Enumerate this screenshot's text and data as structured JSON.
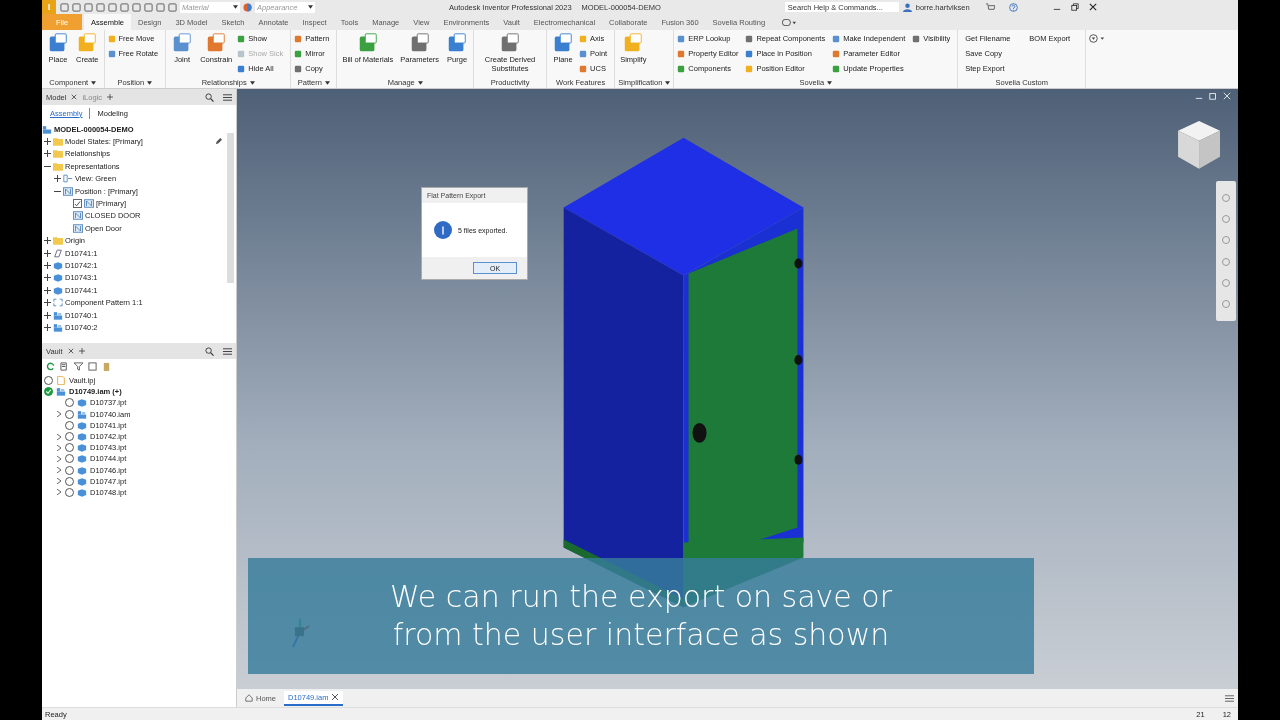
{
  "title_bar": {
    "logo_letter": "I",
    "material": "Material",
    "appearance": "Appearance",
    "app_title": "Autodesk Inventor Professional 2023",
    "document": "MODEL-000054-DEMO",
    "search": {
      "placeholder": "Search Help & Commands..."
    },
    "user": "borre.hartviksen"
  },
  "tabs": [
    {
      "label": "File",
      "kind": "file",
      "selected": false
    },
    {
      "label": "Assemble",
      "kind": "tab",
      "selected": true
    },
    {
      "label": "Design",
      "kind": "tab",
      "selected": false
    },
    {
      "label": "3D Model",
      "kind": "tab",
      "selected": false
    },
    {
      "label": "Sketch",
      "kind": "tab",
      "selected": false
    },
    {
      "label": "Annotate",
      "kind": "tab",
      "selected": false
    },
    {
      "label": "Inspect",
      "kind": "tab",
      "selected": false
    },
    {
      "label": "Tools",
      "kind": "tab",
      "selected": false
    },
    {
      "label": "Manage",
      "kind": "tab",
      "selected": false
    },
    {
      "label": "View",
      "kind": "tab",
      "selected": false
    },
    {
      "label": "Environments",
      "kind": "tab",
      "selected": false
    },
    {
      "label": "Vault",
      "kind": "tab",
      "selected": false
    },
    {
      "label": "Electromechanical",
      "kind": "tab",
      "selected": false
    },
    {
      "label": "Collaborate",
      "kind": "tab",
      "selected": false
    },
    {
      "label": "Fusion 360",
      "kind": "tab",
      "selected": false
    },
    {
      "label": "Sovelia Routing",
      "kind": "tab",
      "selected": false
    }
  ],
  "ribbon": [
    {
      "title": "Component",
      "has_menu": true,
      "tools": [
        {
          "label": "Place",
          "kind": "large"
        },
        {
          "label": "Create",
          "kind": "large"
        }
      ]
    },
    {
      "title": "Position",
      "has_menu": true,
      "tools": [
        {
          "label": "Free Move",
          "kind": "small"
        },
        {
          "label": "Free Rotate",
          "kind": "small"
        }
      ]
    },
    {
      "title": "Relationships",
      "has_menu": true,
      "tools": [
        {
          "label": "Joint",
          "kind": "large"
        },
        {
          "label": "Constrain",
          "kind": "large"
        },
        {
          "label": "Show",
          "kind": "small",
          "disabled": false
        },
        {
          "label": "Show Sick",
          "kind": "small",
          "disabled": true
        },
        {
          "label": "Hide All",
          "kind": "small",
          "disabled": false
        }
      ]
    },
    {
      "title": "Pattern",
      "has_menu": true,
      "tools": [
        {
          "label": "Pattern",
          "kind": "small"
        },
        {
          "label": "Mirror",
          "kind": "small"
        },
        {
          "label": "Copy",
          "kind": "small"
        }
      ]
    },
    {
      "title": "Manage",
      "has_menu": true,
      "tools": [
        {
          "label": "Bill of Materials",
          "kind": "large"
        },
        {
          "label": "Parameters",
          "kind": "large"
        },
        {
          "label": "Purge",
          "kind": "large"
        }
      ]
    },
    {
      "title": "Productivity",
      "has_menu": false,
      "tools": [
        {
          "label": "Create Derived Substitutes",
          "kind": "large"
        }
      ]
    },
    {
      "title": "Work Features",
      "has_menu": false,
      "tools": [
        {
          "label": "Plane",
          "kind": "large"
        },
        {
          "label": "Axis",
          "kind": "small"
        },
        {
          "label": "Point",
          "kind": "small"
        },
        {
          "label": "UCS",
          "kind": "small"
        }
      ]
    },
    {
      "title": "Simplification",
      "has_menu": true,
      "tools": [
        {
          "label": "Simplify",
          "kind": "large"
        }
      ]
    },
    {
      "title": "Sovelia",
      "has_menu": true,
      "tools": [
        {
          "label": "ERP Lookup",
          "kind": "small"
        },
        {
          "label": "Property Editor",
          "kind": "small"
        },
        {
          "label": "Components",
          "kind": "small"
        },
        {
          "label": "Repeat Components",
          "kind": "small"
        },
        {
          "label": "Place in Position",
          "kind": "small"
        },
        {
          "label": "Position Editor",
          "kind": "small"
        },
        {
          "label": "Make Independent",
          "kind": "small"
        },
        {
          "label": "Parameter Editor",
          "kind": "small"
        },
        {
          "label": "Update Properties",
          "kind": "small"
        },
        {
          "label": "Visibility",
          "kind": "small"
        }
      ]
    },
    {
      "title": "Sovelia Custom",
      "has_menu": false,
      "tools": [
        {
          "label": "Get Filename",
          "kind": "text"
        },
        {
          "label": "Save Copy",
          "kind": "text"
        },
        {
          "label": "Step Export",
          "kind": "text"
        },
        {
          "label": "BOM Export",
          "kind": "text"
        }
      ]
    }
  ],
  "model_browser": {
    "tabs": [
      {
        "label": "Model",
        "selected": true
      },
      {
        "label": "iLogic",
        "selected": false
      }
    ],
    "modes": [
      {
        "label": "Assembly",
        "selected": true
      },
      {
        "label": "Modeling",
        "selected": false
      }
    ],
    "root": "MODEL-000054-DEMO",
    "tree": [
      {
        "label": "Model States: [Primary]",
        "kind": "folder",
        "expanded": false,
        "editable": true
      },
      {
        "label": "Relationships",
        "kind": "folder",
        "expanded": false
      },
      {
        "label": "Representations",
        "kind": "folder",
        "expanded": true,
        "children": [
          {
            "label": "View: Green",
            "kind": "view",
            "expanded": false
          },
          {
            "label": "Position : [Primary]",
            "kind": "position",
            "expanded": true,
            "children": [
              {
                "label": "[Primary]",
                "kind": "position",
                "checked": true
              },
              {
                "label": "CLOSED DOOR",
                "kind": "position"
              },
              {
                "label": "Open Door",
                "kind": "position"
              }
            ]
          }
        ]
      },
      {
        "label": "Origin",
        "kind": "folder",
        "expanded": false
      },
      {
        "label": "D10741:1",
        "kind": "flex",
        "expanded": false
      },
      {
        "label": "D10742:1",
        "kind": "part",
        "expanded": false
      },
      {
        "label": "D10743:1",
        "kind": "part",
        "expanded": false
      },
      {
        "label": "D10744:1",
        "kind": "part",
        "expanded": false
      },
      {
        "label": "Component Pattern 1:1",
        "kind": "pattern",
        "expanded": false
      },
      {
        "label": "D10740:1",
        "kind": "assembly",
        "expanded": false
      },
      {
        "label": "D10740:2",
        "kind": "assembly",
        "expanded": false
      }
    ]
  },
  "vault_browser": {
    "title": "Vault",
    "tree": [
      {
        "label": "Vault.ipj",
        "kind": "file",
        "checked": false
      },
      {
        "label": "D10749.iam (+)",
        "kind": "assembly",
        "checked": true,
        "children": [
          {
            "label": "D10737.ipt",
            "kind": "part",
            "checked": false
          },
          {
            "label": "D10740.iam",
            "kind": "assembly",
            "checked": false,
            "expanded": false
          },
          {
            "label": "D10741.ipt",
            "kind": "part",
            "checked": false
          },
          {
            "label": "D10742.ipt",
            "kind": "part",
            "checked": false,
            "expanded": false
          },
          {
            "label": "D10743.ipt",
            "kind": "part",
            "checked": false,
            "expanded": false
          },
          {
            "label": "D10744.ipt",
            "kind": "part",
            "checked": false,
            "expanded": false
          },
          {
            "label": "D10746.ipt",
            "kind": "part",
            "checked": false,
            "expanded": false
          },
          {
            "label": "D10747.ipt",
            "kind": "part",
            "checked": false,
            "expanded": false
          },
          {
            "label": "D10748.ipt",
            "kind": "part",
            "checked": false,
            "expanded": false
          }
        ]
      }
    ]
  },
  "dialog": {
    "title": "Flat Pattern Export",
    "message": "5 files exported.",
    "button": "OK"
  },
  "caption": "We can run the export on save or from the user interface as shown",
  "document_tabs": [
    {
      "label": "Home",
      "kind": "home",
      "selected": false
    },
    {
      "label": "D10749.iam",
      "kind": "document",
      "selected": true
    }
  ],
  "status_bar": {
    "message": "Ready",
    "values": [
      "21",
      "12"
    ]
  }
}
